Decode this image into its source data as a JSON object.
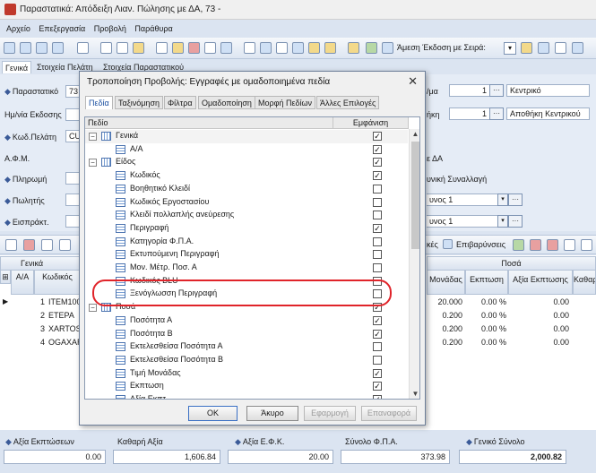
{
  "window": {
    "title": "Παραστατικά: Απόδειξη Λιαν. Πώλησης με ΔΑ, 73  -"
  },
  "menu": [
    "Αρχείο",
    "Επεξεργασία",
    "Προβολή",
    "Παράθυρα"
  ],
  "toolbar": {
    "direct_issue": "Άμεση Έκδοση με Σειρά:"
  },
  "tabs": [
    "Γενικά",
    "Στοιχεία Πελάτη",
    "Στοιχεία Παραστατικού"
  ],
  "form": {
    "parastatiko_label": "Παραστατικό",
    "parastatiko_value": "73",
    "date_label": "Ημ/νία Εκδοσης",
    "customer_code_label": "Κωδ.Πελάτη",
    "customer_code_value": "CUS",
    "afm_label": "Α.Φ.Μ.",
    "payment_label": "Πληρωμή",
    "seller_label": "Πωλητής",
    "collector_label": "Εισπράκτ.",
    "right_label1": "/μα",
    "right_label2": "ήκη",
    "store_num": "1",
    "store_value": "Κεντρικό",
    "warehouse_num": "1",
    "warehouse_value": "Αποθήκη Κεντρικού",
    "da_value": "ε ΔΑ",
    "transaction_label": "υνική Συναλλαγή",
    "combo1": "υνος 1",
    "combo2": "υνος 1",
    "charges_label": "Επιβαρύνσεις",
    "discounts_label": "κές"
  },
  "grid": {
    "group_general": "Γενικά",
    "group_amounts": "Ποσά",
    "col_aa": "Α/Α",
    "col_code": "Κωδικός",
    "col_unit": "Μονάδας",
    "col_discount": "Εκπτωση",
    "col_discount_value": "Αξία Εκπτωσης",
    "col_net": "Καθαρ",
    "rows": [
      {
        "aa": "1",
        "code": "ITEM100",
        "unit": "20.000",
        "disc": "0.00 %",
        "disc_value": "0.00"
      },
      {
        "aa": "2",
        "code": "ETEPA",
        "unit": "0.200",
        "disc": "0.00 %",
        "disc_value": "0.00"
      },
      {
        "aa": "3",
        "code": "XARTOS",
        "unit": "0.200",
        "disc": "0.00 %",
        "disc_value": "0.00"
      },
      {
        "aa": "4",
        "code": "OGAXAR",
        "unit": "0.200",
        "disc": "0.00 %",
        "disc_value": "0.00"
      }
    ]
  },
  "totals": {
    "discount_value_label": "Αξία Εκπτώσεων",
    "discount_value": "0.00",
    "net_value_label": "Καθαρή Αξία",
    "net_value": "1,606.84",
    "efk_label": "Αξία Ε.Φ.Κ.",
    "efk_value": "20.00",
    "vat_label": "Σύνολο Φ.Π.Α.",
    "vat_value": "373.98",
    "grand_total_label": "Γενικό Σύνολο",
    "grand_total_value": "2,000.82"
  },
  "dialog": {
    "title": "Τροποποίηση Προβολής: Εγγραφές με ομαδοποιημένα πεδία",
    "tabs": [
      "Πεδία",
      "Ταξινόμηση",
      "Φίλτρα",
      "Ομαδοποίηση",
      "Μορφή Πεδίων",
      "Άλλες Επιλογές"
    ],
    "col_field": "Πεδίο",
    "col_display": "Εμφάνιση",
    "rows": [
      {
        "label": "Γενικά",
        "checked": true,
        "group": true
      },
      {
        "label": "Α/Α",
        "checked": true,
        "group": false
      },
      {
        "label": "Είδος",
        "checked": true,
        "group": true
      },
      {
        "label": "Κωδικός",
        "checked": true,
        "group": false
      },
      {
        "label": "Βοηθητικό Κλειδί",
        "checked": false,
        "group": false
      },
      {
        "label": "Κωδικός Εργοστασίου",
        "checked": false,
        "group": false
      },
      {
        "label": "Κλειδί πολλαπλής ανεύρεσης",
        "checked": false,
        "group": false
      },
      {
        "label": "Περιγραφή",
        "checked": true,
        "group": false
      },
      {
        "label": "Κατηγορία Φ.Π.Α.",
        "checked": false,
        "group": false
      },
      {
        "label": "Εκτυπούμενη Περιγραφή",
        "checked": false,
        "group": false
      },
      {
        "label": "Μον. Μέτρ. Ποσ. Α",
        "checked": false,
        "group": false
      },
      {
        "label": "Κωδικός BLU",
        "checked": false,
        "group": false
      },
      {
        "label": "Ξενόγλωσση Περιγραφή",
        "checked": false,
        "group": false
      },
      {
        "label": "Ποσά",
        "checked": true,
        "group": true
      },
      {
        "label": "Ποσότητα Α",
        "checked": true,
        "group": false
      },
      {
        "label": "Ποσότητα Β",
        "checked": true,
        "group": false
      },
      {
        "label": "Εκτελεσθείσα Ποσότητα Α",
        "checked": false,
        "group": false
      },
      {
        "label": "Εκτελεσθείσα Ποσότητα Β",
        "checked": false,
        "group": false
      },
      {
        "label": "Τιμή Μονάδας",
        "checked": true,
        "group": false
      },
      {
        "label": "Εκπτωση",
        "checked": true,
        "group": false
      },
      {
        "label": "Αξία Εκπτ.",
        "checked": true,
        "group": false
      }
    ],
    "buttons": {
      "ok": "ΟΚ",
      "cancel": "Άκυρο",
      "apply": "Εφαρμογή",
      "restore": "Επαναφορά"
    }
  }
}
